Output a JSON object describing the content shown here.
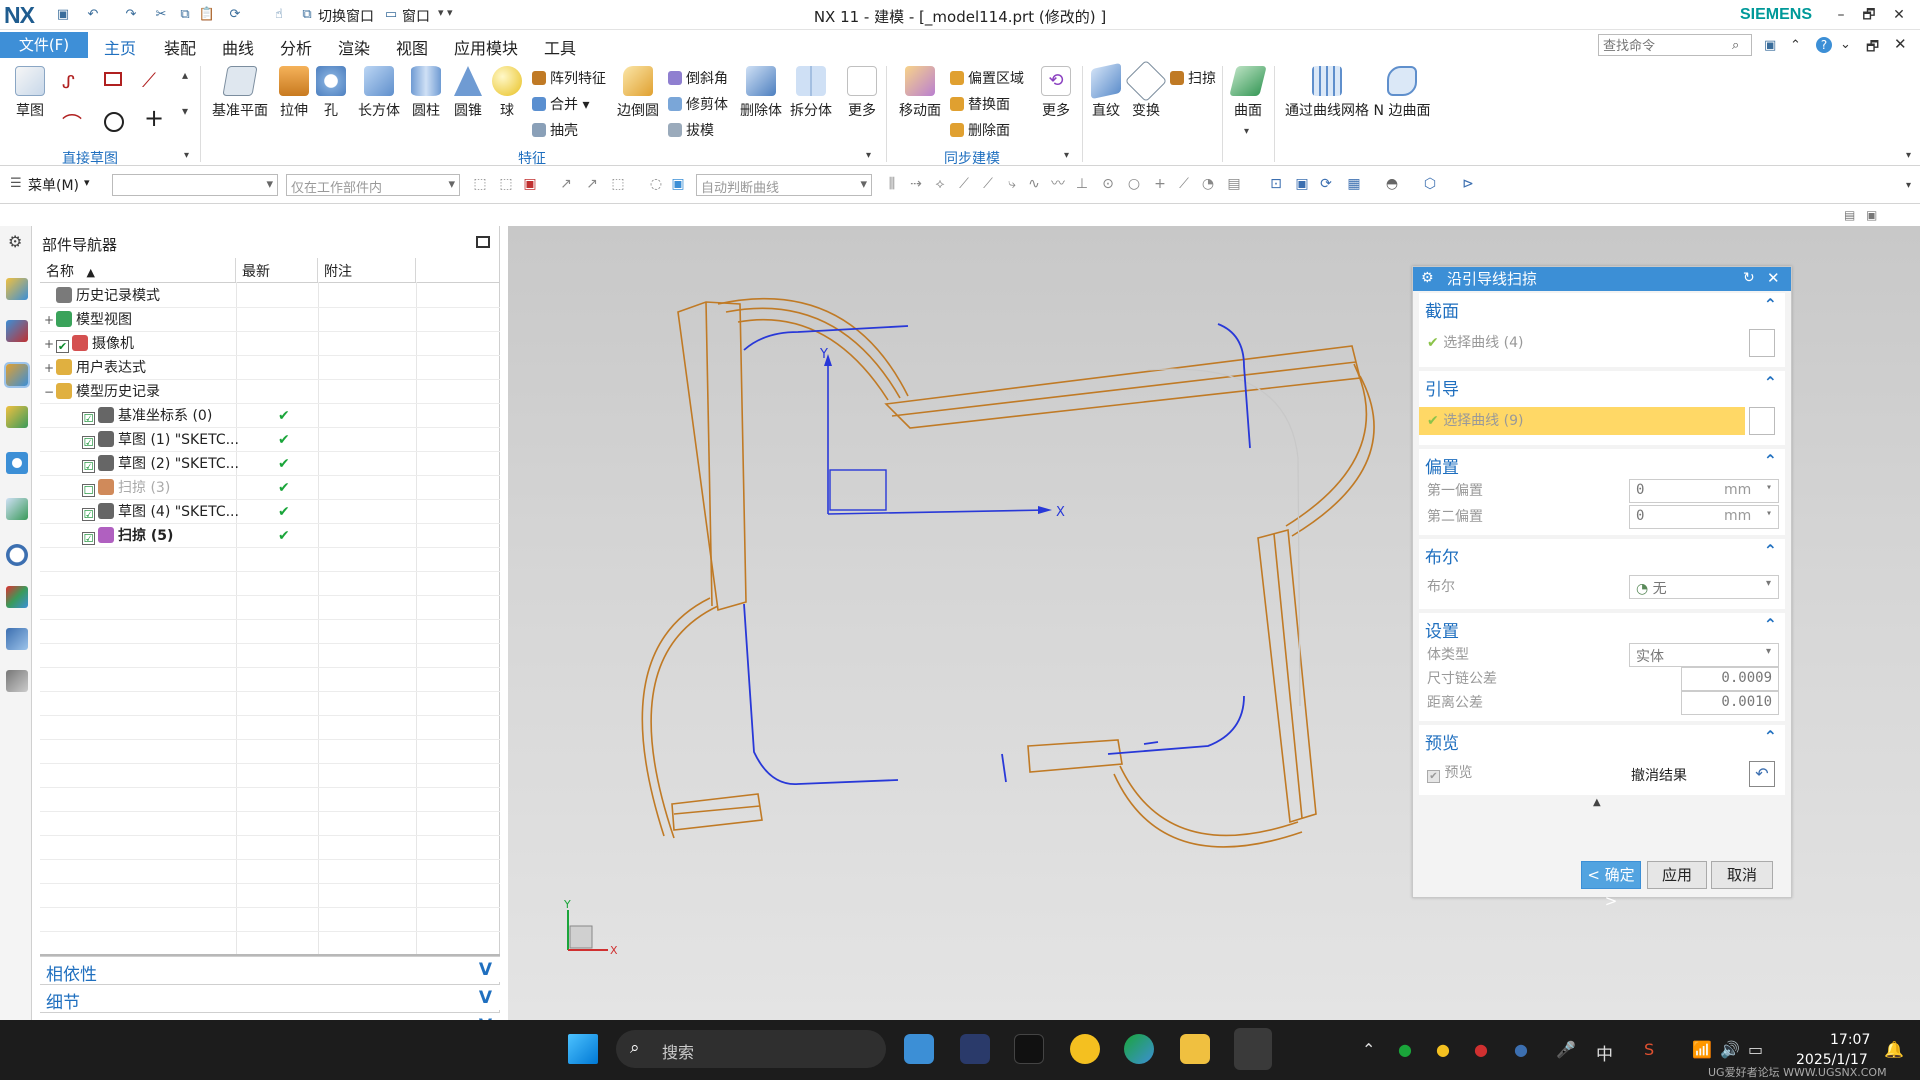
{
  "titlebar": {
    "logo": "NX",
    "switch_window": "切换窗口",
    "window_menu": "窗口",
    "title": "NX 11 - 建模 - [_model114.prt  (修改的) ]",
    "brand": "SIEMENS",
    "minimize": "–",
    "restore": "🗗",
    "close": "✕"
  },
  "tabs": {
    "file": "文件(F)",
    "items": [
      "主页",
      "装配",
      "曲线",
      "分析",
      "渲染",
      "视图",
      "应用模块",
      "工具"
    ],
    "active": "主页",
    "search_placeholder": "查找命令"
  },
  "ribbon": {
    "sketch": "草图",
    "direct_sketch_group": "直接草图",
    "datum_plane": "基准平面",
    "extrude": "拉伸",
    "hole": "孔",
    "block": "长方体",
    "cylinder": "圆柱",
    "cone": "圆锥",
    "sphere": "球",
    "pattern_feature": "阵列特征",
    "unite": "合并",
    "shell": "抽壳",
    "edge_blend": "边倒圆",
    "chamfer": "倒斜角",
    "trim_body": "修剪体",
    "draft": "拔模",
    "delete_body": "删除体",
    "split_body": "拆分体",
    "more1": "更多",
    "feature_group": "特征",
    "move_face": "移动面",
    "offset_region": "偏置区域",
    "replace_face": "替换面",
    "delete_face": "删除面",
    "more2": "更多",
    "sync_group": "同步建模",
    "ruled": "直纹",
    "transform": "变换",
    "sweep": "扫掠",
    "surface": "曲面",
    "through_curve_mesh": "通过曲线网格",
    "n_sided_surface": "N 边曲面"
  },
  "toolbar": {
    "menu": "菜单(M)",
    "filter_value": "",
    "scope": "仅在工作部件内",
    "curve_rule": "自动判断曲线"
  },
  "navigator": {
    "title": "部件导航器",
    "columns": [
      "名称",
      "最新",
      "附注"
    ],
    "rows": [
      {
        "indent": 0,
        "expander": "",
        "check": "",
        "icon_color": "#7a7a7a",
        "label": "历史记录模式",
        "latest": "",
        "dim": false,
        "bold": false
      },
      {
        "indent": 0,
        "expander": "+",
        "check": "",
        "icon_color": "#3aa35b",
        "label": "模型视图",
        "latest": "",
        "dim": false,
        "bold": false
      },
      {
        "indent": 0,
        "expander": "+",
        "check": "✔",
        "icon_color": "#d45050",
        "label": "摄像机",
        "latest": "",
        "dim": false,
        "bold": false
      },
      {
        "indent": 0,
        "expander": "+",
        "check": "",
        "icon_color": "#e0b040",
        "label": "用户表达式",
        "latest": "",
        "dim": false,
        "bold": false
      },
      {
        "indent": 0,
        "expander": "−",
        "check": "",
        "icon_color": "#e0b040",
        "label": "模型历史记录",
        "latest": "",
        "dim": false,
        "bold": false
      },
      {
        "indent": 1,
        "expander": "",
        "check": "☑",
        "icon_color": "#666666",
        "label": "基准坐标系 (0)",
        "latest": "✔",
        "dim": false,
        "bold": false
      },
      {
        "indent": 1,
        "expander": "",
        "check": "☑",
        "icon_color": "#666666",
        "label": "草图 (1) \"SKETC...",
        "latest": "✔",
        "dim": false,
        "bold": false
      },
      {
        "indent": 1,
        "expander": "",
        "check": "☑",
        "icon_color": "#666666",
        "label": "草图 (2) \"SKETC...",
        "latest": "✔",
        "dim": false,
        "bold": false
      },
      {
        "indent": 1,
        "expander": "",
        "check": "☐",
        "icon_color": "#d08a5a",
        "label": "扫掠 (3)",
        "latest": "✔",
        "dim": true,
        "bold": false
      },
      {
        "indent": 1,
        "expander": "",
        "check": "☑",
        "icon_color": "#666666",
        "label": "草图 (4) \"SKETC...",
        "latest": "✔",
        "dim": false,
        "bold": false
      },
      {
        "indent": 1,
        "expander": "",
        "check": "☑",
        "icon_color": "#b060c0",
        "label": "扫掠 (5)",
        "latest": "✔",
        "dim": false,
        "bold": true
      }
    ],
    "panels": [
      "相依性",
      "细节",
      "预览"
    ]
  },
  "viewport": {
    "axis_x": "X",
    "axis_y": "Y",
    "triad_x": "X",
    "triad_y": "Y"
  },
  "dialog": {
    "title": "沿引导线扫掠",
    "section_heading": "截面",
    "section_select": "选择曲线 (4)",
    "guide_heading": "引导",
    "guide_select": "选择曲线 (9)",
    "offset_heading": "偏置",
    "first_offset_label": "第一偏置",
    "first_offset_value": "0",
    "first_offset_unit": "mm",
    "second_offset_label": "第二偏置",
    "second_offset_value": "0",
    "second_offset_unit": "mm",
    "boolean_heading": "布尔",
    "boolean_label": "布尔",
    "boolean_value": "无",
    "settings_heading": "设置",
    "body_type_label": "体类型",
    "body_type_value": "实体",
    "chain_tol_label": "尺寸链公差",
    "chain_tol_value": "0.0009",
    "dist_tol_label": "距离公差",
    "dist_tol_value": "0.0010",
    "preview_heading": "预览",
    "preview_label": "预览",
    "undo_result": "撤消结果",
    "ok": "< 确定 >",
    "apply": "应用",
    "cancel": "取消"
  },
  "taskbar": {
    "search": "搜索",
    "ime": "中",
    "time": "17:07",
    "date": "2025/1/17",
    "watermark": "UG爱好者论坛 WWW.UGSNX.COM"
  },
  "colors": {
    "accent": "#3c8fd6",
    "model_edge": "#c07a25",
    "guide_curve": "#2838d8",
    "highlight_field": "#ffd866",
    "siemens": "#009999"
  }
}
